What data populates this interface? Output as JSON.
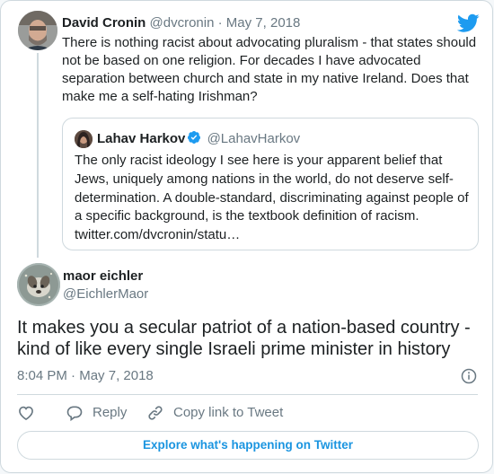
{
  "parent_tweet": {
    "author_name": "David Cronin",
    "author_handle": "@dvcronin",
    "separator": "·",
    "date": "May 7, 2018",
    "text": "There is nothing racist about advocating pluralism - that states should not be based on one religion. For decades I have advocated separation between church and state in my native Ireland. Does that make me a self-hating Irishman?"
  },
  "quoted_tweet": {
    "author_name": "Lahav Harkov",
    "author_handle": "@LahavHarkov",
    "verified_icon": "verified-badge-icon",
    "text": "The only racist ideology I see here is your apparent belief that Jews, uniquely among nations in the world, do not deserve self-determination. A double-standard, discriminating against people of a specific background, is the textbook definition of racism.",
    "link": "twitter.com/dvcronin/statu…"
  },
  "main_tweet": {
    "author_name": "maor eichler",
    "author_handle": "@EichlerMaor",
    "text": "It makes you a secular patriot of a nation-based country - kind of like every single Israeli prime minister in history",
    "time": "8:04 PM",
    "date_separator": "·",
    "date": "May 7, 2018"
  },
  "actions": {
    "like_icon": "heart-icon",
    "reply_label": "Reply",
    "reply_icon": "speech-bubble-icon",
    "copy_link_label": "Copy link to Tweet",
    "copy_link_icon": "link-icon"
  },
  "explore_button_label": "Explore what's happening on Twitter",
  "colors": {
    "twitter_blue": "#1d9bf0",
    "link_blue": "#1b95e0",
    "muted_text": "#697882",
    "border": "#cfd9de"
  }
}
